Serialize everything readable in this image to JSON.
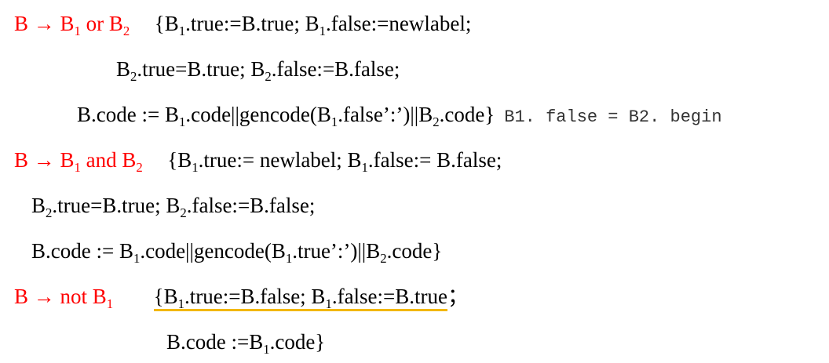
{
  "sym": {
    "B": "B",
    "B1": "B",
    "B2": "B",
    "s1": "1",
    "s2": "2"
  },
  "rule_or": {
    "head": "B → B",
    "or": " or B",
    "l1": "{B",
    "l1a": ".true:=B.true; B",
    "l1b": ".false:=newlabel;",
    "l2a": "B",
    "l2b": ".true=B.true; B",
    "l2c": ".false:=B.false;",
    "l3a": "B.code := B",
    "l3b": ".code||gencode(B",
    "l3c": ".false’:’)||B",
    "l3d": ".code}",
    "note": "B1. false = B2. begin"
  },
  "rule_and": {
    "head": "B → B",
    "and": " and B",
    "l1": "{B",
    "l1a": ".true:= newlabel; B",
    "l1b": ".false:= B.false;",
    "l2a": "B",
    "l2b": ".true=B.true; B",
    "l2c": ".false:=B.false;",
    "l3a": "B.code := B",
    "l3b": ".code||gencode(B",
    "l3c": ".true’:’)||B",
    "l3d": ".code}"
  },
  "rule_not": {
    "head": "B → not B",
    "l1": "{B",
    "l1a": ".true:=B.false; B",
    "l1b": ".false:=B.true",
    "semicolon": "；",
    "l2a": "B.code :=B",
    "l2b": ".code}"
  },
  "colors": {
    "production": "#ff0000",
    "text": "#000000",
    "note": "#333333",
    "highlight": "#f2b705"
  }
}
